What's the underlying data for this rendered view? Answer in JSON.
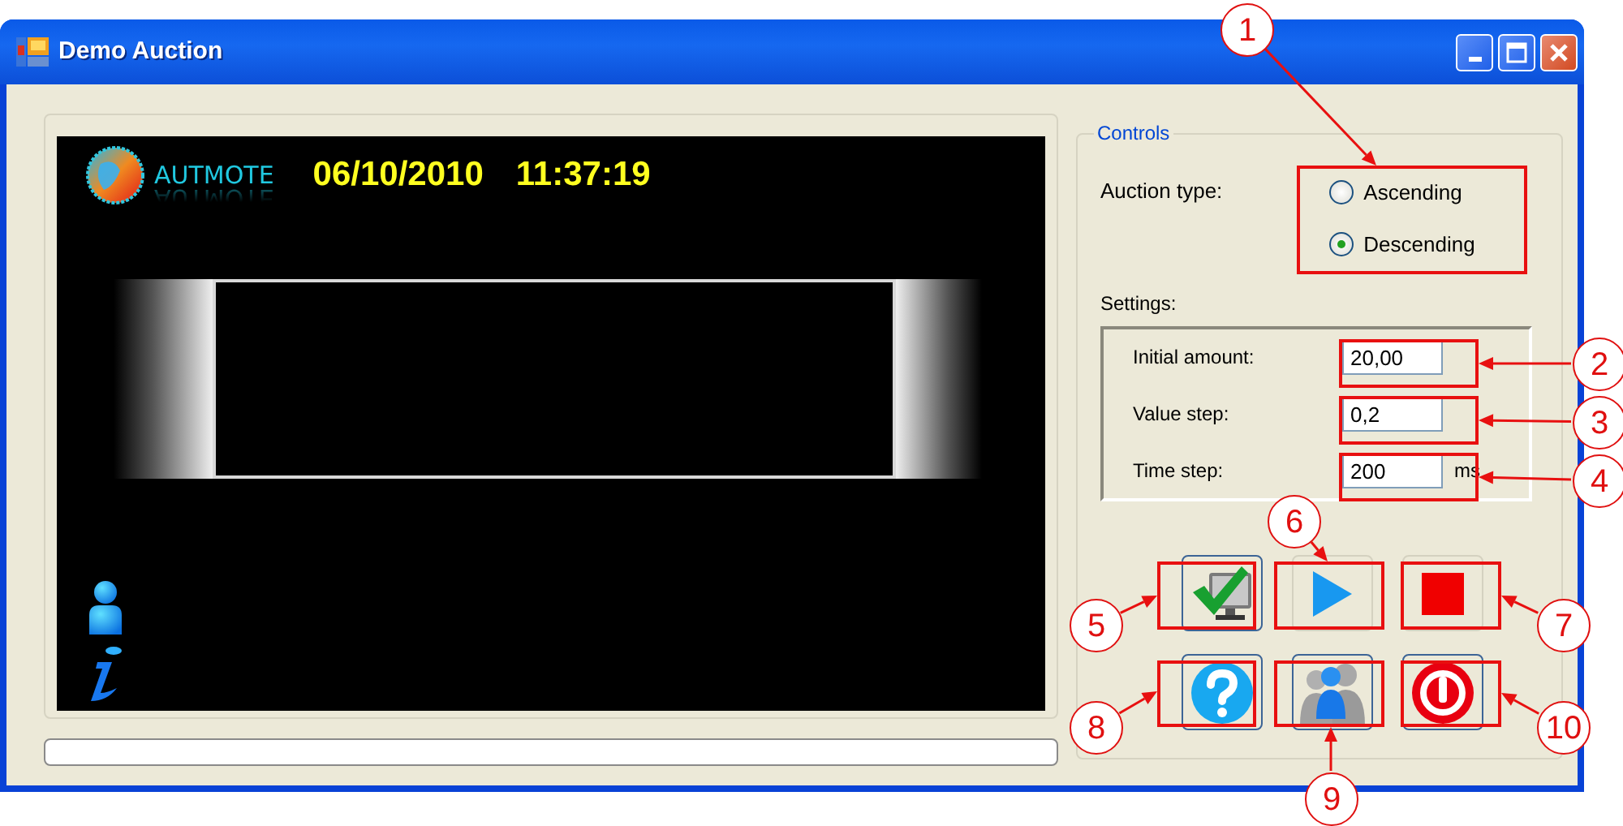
{
  "window": {
    "title": "Demo Auction"
  },
  "display": {
    "logo_text": "AUTMOTE",
    "date": "06/10/2010",
    "time": "11:37:19"
  },
  "controls": {
    "legend": "Controls",
    "auction_type_label": "Auction type:",
    "auction_types": [
      {
        "label": "Ascending",
        "selected": false
      },
      {
        "label": "Descending",
        "selected": true
      }
    ],
    "settings_label": "Settings:",
    "settings": [
      {
        "label": "Initial amount:",
        "value": "20,00"
      },
      {
        "label": "Value step:",
        "value": "0,2"
      },
      {
        "label": "Time step:",
        "value": "200",
        "unit": "ms"
      }
    ],
    "buttons": [
      {
        "kind": "confirm",
        "disabled": false
      },
      {
        "kind": "play",
        "disabled": true
      },
      {
        "kind": "stop",
        "disabled": true
      },
      {
        "kind": "help",
        "disabled": false
      },
      {
        "kind": "users",
        "disabled": false
      },
      {
        "kind": "power",
        "disabled": false
      }
    ]
  },
  "callouts": [
    {
      "number": "1"
    },
    {
      "number": "2"
    },
    {
      "number": "3"
    },
    {
      "number": "4"
    },
    {
      "number": "5"
    },
    {
      "number": "6"
    },
    {
      "number": "7"
    },
    {
      "number": "8"
    },
    {
      "number": "9"
    },
    {
      "number": "10"
    }
  ]
}
